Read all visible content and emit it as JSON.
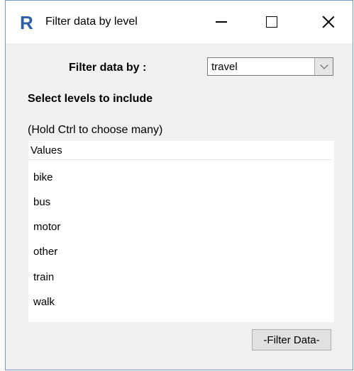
{
  "window": {
    "title": "Filter data by level"
  },
  "filter": {
    "label": "Filter data by :",
    "selected_value": "travel"
  },
  "levels": {
    "heading": "Select levels to include",
    "hint": "(Hold Ctrl to choose many)",
    "column_header": "Values",
    "items": [
      "bike",
      "bus",
      "motor",
      "other",
      "train",
      "walk"
    ]
  },
  "actions": {
    "filter_button": "-Filter Data-"
  },
  "icons": {
    "app": "r-logo-icon",
    "minimize": "minimize-icon",
    "maximize": "maximize-icon",
    "close": "close-icon",
    "dropdown": "chevron-down-icon"
  },
  "colors": {
    "window_border": "#6f9ad2",
    "r_logo": "#2c5fa8"
  }
}
